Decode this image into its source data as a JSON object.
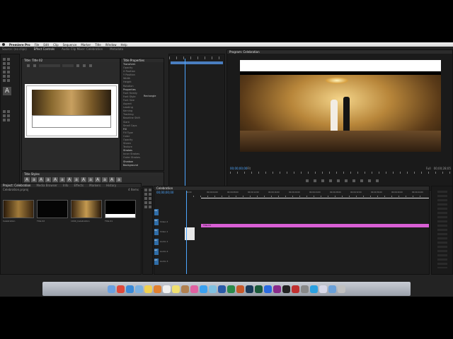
{
  "menubar": {
    "app": "Premiere Pro",
    "items": [
      "File",
      "Edit",
      "Clip",
      "Sequence",
      "Marker",
      "Title",
      "Window",
      "Help"
    ]
  },
  "workspace": {
    "tabs": [
      "Source: (no clips)",
      "Effect Controls",
      "Audio Clip Mixer: Celebration",
      "Metadata"
    ],
    "active": 1
  },
  "title_panel": {
    "tab": "Title: Title 02",
    "properties_header": "Title Properties",
    "sections": [
      "Transform",
      "Opacity",
      "X Position",
      "Y Position",
      "Width",
      "Height",
      "Rotation",
      "Properties",
      "Font Family",
      "Font Style",
      "Font Size",
      "Aspect",
      "Leading",
      "Kerning",
      "Tracking",
      "Baseline Shift",
      "Slant",
      "Small Caps",
      "Fill",
      "Fill Type",
      "Color",
      "Opacity",
      "Sheen",
      "Texture",
      "Strokes",
      "Inner Strokes",
      "Outer Strokes",
      "Shadow",
      "Background"
    ],
    "rect_option": "Rectangle",
    "styles_tab": "Title Styles"
  },
  "program": {
    "header": "Program: Celebration",
    "timecode_left": "00;00;00;00",
    "fit": "Fit",
    "timecode_right": "00;00;28;05",
    "zoom": "Full"
  },
  "project": {
    "tabs": [
      "Project: Celebration",
      "Media Browser",
      "Info",
      "Effects",
      "Markers",
      "History"
    ],
    "file": "Celebration.prproj",
    "items_count": "4 Items",
    "clips": [
      {
        "name": "Celebration",
        "dur": "5:09:00"
      },
      {
        "name": "Title 02",
        "dur": ""
      },
      {
        "name": "1000_Celebration",
        "dur": "5:09:00"
      },
      {
        "name": "Title 01",
        "dur": ""
      }
    ]
  },
  "timeline": {
    "tab": "Celebration",
    "timecode": "00;00;00;00",
    "tracks": [
      "V3",
      "V2",
      "V1",
      "A1",
      "A2",
      "A3"
    ],
    "track_labels": [
      "Video 2",
      "Video 1",
      "Audio 1",
      "Audio 2",
      "Audio 3"
    ],
    "clip": "Title 01",
    "ruler": [
      "00;00",
      "00;00;04;00",
      "00;00;08;00",
      "00;00;12;00",
      "00;00;16;00",
      "00;00;20;00",
      "00;00;24;00",
      "00;00;28;00",
      "00;00;32;00",
      "00;00;36;00",
      "00;00;40;00",
      "00;00;44;00"
    ]
  },
  "dock": {
    "apps": [
      "Finder",
      "Chrome",
      "Safari",
      "Mail",
      "Notes",
      "Photos",
      "Calendar",
      "Stickies",
      "Contacts",
      "iTunes",
      "App Store",
      "Preview",
      "Word",
      "Excel",
      "PowerPoint",
      "Lightroom",
      "SpeedGrade",
      "Photoshop",
      "Premiere Pro",
      "Terminal",
      "Photo Booth",
      "Chess",
      "Skype",
      "Documents",
      "Downloads",
      "Trash"
    ]
  },
  "colors": {
    "pink": "#d85fd4",
    "blue": "#2f6da8",
    "playhead": "#4da6ff"
  }
}
